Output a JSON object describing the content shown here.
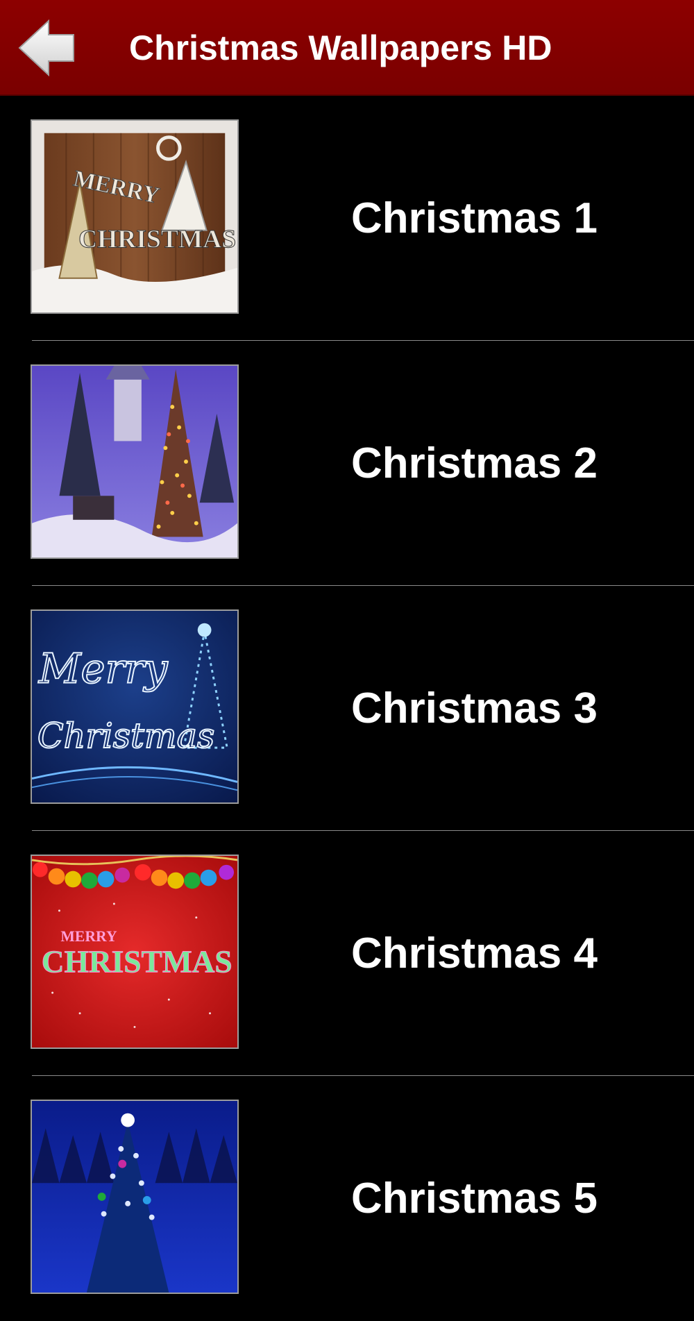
{
  "header": {
    "title": "Christmas Wallpapers HD",
    "background": "#8d0000"
  },
  "list": {
    "items": [
      {
        "label": "Christmas 1"
      },
      {
        "label": "Christmas 2"
      },
      {
        "label": "Christmas 3"
      },
      {
        "label": "Christmas 4"
      },
      {
        "label": "Christmas 5"
      }
    ]
  },
  "thumbnails": {
    "thumb1": {
      "text": [
        "MERRY",
        "CHRISTMAS"
      ]
    },
    "thumb3": {
      "text": [
        "Merry",
        "Christmas"
      ]
    },
    "thumb4": {
      "text": [
        "MERRY",
        "CHRISTMAS"
      ]
    }
  }
}
